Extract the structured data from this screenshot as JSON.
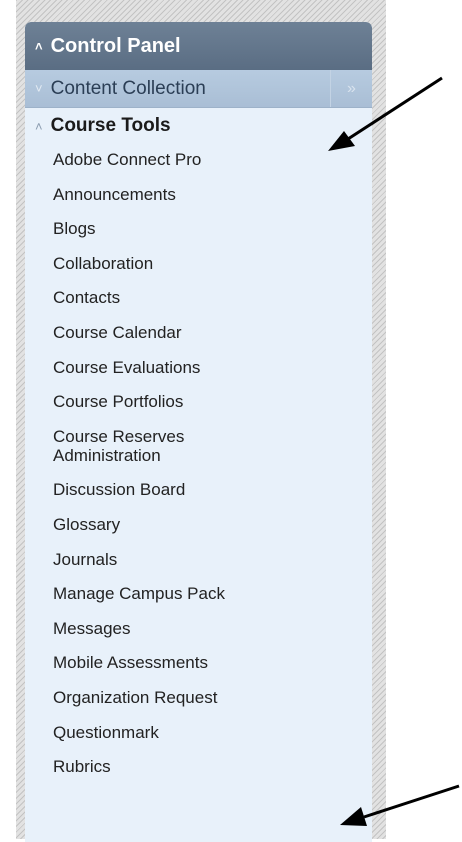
{
  "panel": {
    "title": "Control Panel",
    "title_chevron": "«"
  },
  "content_collection": {
    "label": "Content Collection",
    "chevron": "«",
    "expand_icon": "»"
  },
  "course_tools": {
    "label": "Course Tools",
    "chevron": "«",
    "items": [
      "Adobe Connect Pro",
      "Announcements",
      "Blogs",
      "Collaboration",
      "Contacts",
      "Course Calendar",
      "Course Evaluations",
      "Course Portfolios",
      "Course Reserves Administration",
      "Discussion Board",
      "Glossary",
      "Journals",
      "Manage Campus Pack",
      "Messages",
      "Mobile Assessments",
      "Organization Request",
      "Questionmark",
      "Rubrics"
    ]
  },
  "colors": {
    "header": "#5f7289",
    "collection_bar": "#afc3d9",
    "panel_bg": "#e8f1fa",
    "arrow": "#000000"
  }
}
